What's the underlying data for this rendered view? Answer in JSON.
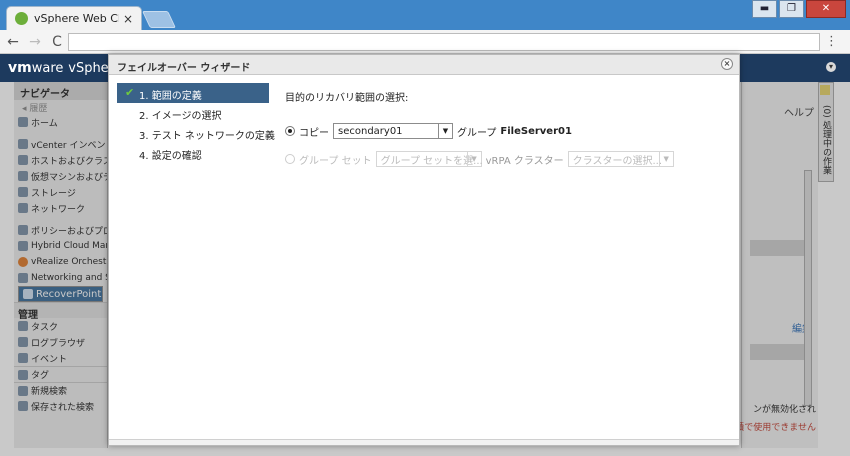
{
  "browser": {
    "tab_title": "vSphere Web Client",
    "tab_close": "×",
    "back": "←",
    "forward": "→",
    "reload": "C",
    "menu": "⋮",
    "win_min": "▬",
    "win_max": "❐",
    "win_close": "✕"
  },
  "app": {
    "logo_vm": "vm",
    "logo_ware": "ware",
    "logo_product": "vSpher"
  },
  "navigator": {
    "title": "ナビゲータ",
    "history": "◂ 履歴",
    "items": [
      {
        "label": "ホーム"
      },
      {
        "label": "vCenter インベント"
      },
      {
        "label": "ホストおよびクラス"
      },
      {
        "label": "仮想マシンおよびテ"
      },
      {
        "label": "ストレージ"
      },
      {
        "label": "ネットワーク"
      },
      {
        "label": "ポリシーおよびプロ"
      },
      {
        "label": "Hybrid Cloud Manag"
      },
      {
        "label": "vRealize Orchestrat"
      },
      {
        "label": "Networking and Sec"
      },
      {
        "label": "RecoverPoint for VM"
      }
    ],
    "admin_label": "管理",
    "admin_items": [
      {
        "label": "タスク"
      },
      {
        "label": "ログブラウザ"
      },
      {
        "label": "イベント"
      }
    ],
    "tags": "タグ",
    "new_search": "新規検索",
    "saved_search": "保存された検索"
  },
  "right_pane": {
    "help": "ヘルプ",
    "edit": "編集",
    "disabled_text": "ンが無効化され",
    "cannot_use": "績で使用できません",
    "side_tab": "(0) 処理中の作業"
  },
  "modal": {
    "title": "フェイルオーバー ウィザード",
    "close": "×",
    "steps": [
      {
        "label": "1. 範囲の定義",
        "active": true
      },
      {
        "label": "2. イメージの選択",
        "active": false
      },
      {
        "label": "3. テスト ネットワークの定義",
        "active": false
      },
      {
        "label": "4. 設定の確認",
        "active": false
      }
    ],
    "check_mark": "✔",
    "content_title": "目的のリカバリ範囲の選択:",
    "copy_label": "コピー",
    "copy_value": "secondary01",
    "group_label": "グループ",
    "group_value": "FileServer01",
    "group_set_label": "グループ セット",
    "group_set_placeholder": "グループ セットを選...",
    "vrpa_label": "vRPA クラスター",
    "cluster_placeholder": "クラスターの選択..."
  },
  "colors": {
    "browser_blue": "#3f86c8",
    "app_header": "#1d3a5e",
    "active_step": "#3a6289",
    "check_green": "#6fcb3e"
  }
}
